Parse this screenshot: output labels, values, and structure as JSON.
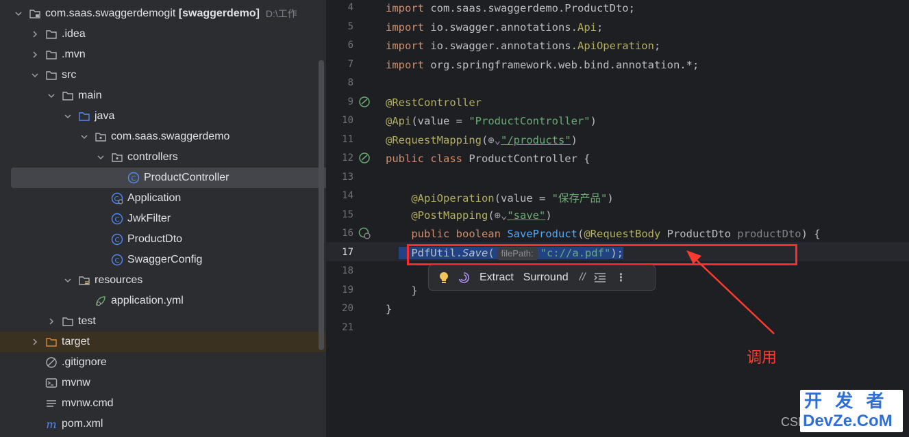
{
  "project_tree": {
    "root": {
      "name": "com.saas.swaggerdemogit",
      "module": "[swaggerdemo]",
      "path": "D:\\工作"
    },
    "items": [
      {
        "label": ".idea",
        "kind": "folder"
      },
      {
        "label": ".mvn",
        "kind": "folder"
      },
      {
        "label": "src",
        "kind": "folder"
      },
      {
        "label": "main",
        "kind": "folder"
      },
      {
        "label": "java",
        "kind": "source-folder"
      },
      {
        "label": "com.saas.swaggerdemo",
        "kind": "package"
      },
      {
        "label": "controllers",
        "kind": "package"
      },
      {
        "label": "ProductController",
        "kind": "class",
        "selected": true
      },
      {
        "label": "Application",
        "kind": "spring-class"
      },
      {
        "label": "JwkFilter",
        "kind": "class"
      },
      {
        "label": "ProductDto",
        "kind": "class"
      },
      {
        "label": "SwaggerConfig",
        "kind": "class"
      },
      {
        "label": "resources",
        "kind": "resources-folder"
      },
      {
        "label": "application.yml",
        "kind": "yml"
      },
      {
        "label": "test",
        "kind": "folder"
      },
      {
        "label": "target",
        "kind": "excluded-folder"
      },
      {
        "label": ".gitignore",
        "kind": "ignore-file"
      },
      {
        "label": "mvnw",
        "kind": "script"
      },
      {
        "label": "mvnw.cmd",
        "kind": "text-file"
      },
      {
        "label": "pom.xml",
        "kind": "maven-file"
      }
    ]
  },
  "editor": {
    "line_numbers": [
      "4",
      "5",
      "6",
      "7",
      "8",
      "9",
      "10",
      "11",
      "12",
      "13",
      "14",
      "15",
      "16",
      "17",
      "18",
      "19",
      "20",
      "21"
    ],
    "lines": {
      "l4_pkg": "com.saas.swaggerdemo.ProductDto;",
      "l5_pkg": "io.swagger.annotations.",
      "l5_cls": "Api",
      "l6_pkg": "io.swagger.annotations.",
      "l6_cls": "ApiOperation",
      "l7_pkg": "org.springframework.web.bind.annotation.*;",
      "import_kw": "import",
      "l9": "@RestController",
      "l10_ann": "@Api",
      "l10_open": "(value = ",
      "l10_str": "\"ProductController\"",
      "l10_close": ")",
      "l11_ann": "@RequestMapping",
      "l11_str": "\"/products\"",
      "l12_kw": "public class",
      "l12_rest": " ProductController {",
      "l14_ann": "@ApiOperation",
      "l14_open": "(value = ",
      "l14_str": "\"保存产品\"",
      "l14_close": ")",
      "l15_ann": "@PostMapping",
      "l15_str": "\"save\"",
      "l16_kw": "public boolean",
      "l16_fn": "SaveProduct",
      "l16_ann": "@RequestBody",
      "l16_type": " ProductDto ",
      "l16_param": "productDto",
      "l16_end": ") {",
      "l17_cls": "PdfUtil.",
      "l17_fn": "Save",
      "l17_hint": "filePath:",
      "l17_str": "\"c://a.pdf\"",
      "l17_end": ");",
      "l19": "}",
      "l20": "}"
    },
    "popup": {
      "extract": "Extract",
      "surround": "Surround"
    },
    "current_line": "17"
  },
  "annotation": {
    "label": "调用",
    "color": "#ff3b30"
  },
  "watermark": {
    "text": "开 发 者\nDevZe.CoM",
    "prefix": "CSD"
  }
}
